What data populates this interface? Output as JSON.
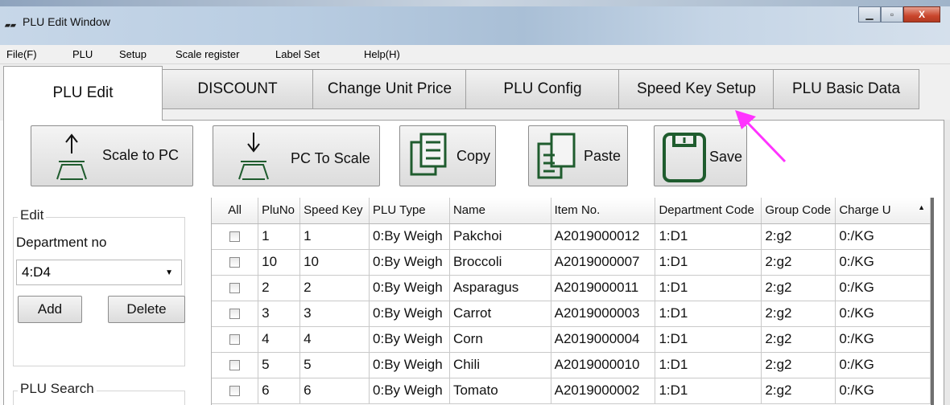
{
  "window": {
    "title": "PLU Edit Window",
    "icon": "app-logo-icon"
  },
  "menu": [
    "File(F)",
    "PLU",
    "Setup",
    "Scale register",
    "Label Set",
    "Help(H)"
  ],
  "tabs": [
    "PLU Edit",
    "DISCOUNT",
    "Change Unit Price",
    "PLU Config",
    "Speed Key Setup",
    "PLU Basic Data"
  ],
  "active_tab": "PLU Edit",
  "toolbar": {
    "scale_to_pc": "Scale to PC",
    "pc_to_scale": "PC To Scale",
    "copy": "Copy",
    "paste": "Paste",
    "save": "Save"
  },
  "left_panel": {
    "edit_group": "Edit",
    "department_label": "Department no",
    "department_value": "4:D4",
    "add": "Add",
    "delete": "Delete",
    "search_group": "PLU Search"
  },
  "grid": {
    "columns": [
      "All",
      "PluNo",
      "Speed Key",
      "PLU Type",
      "Name",
      "Item No.",
      "Department Code",
      "Group Code",
      "Charge U"
    ],
    "rows": [
      [
        "1",
        "1",
        "0:By Weigh",
        "Pakchoi",
        "A2019000012",
        "1:D1",
        "2:g2",
        "0:/KG"
      ],
      [
        "10",
        "10",
        "0:By Weigh",
        "Broccoli",
        "A2019000007",
        "1:D1",
        "2:g2",
        "0:/KG"
      ],
      [
        "2",
        "2",
        "0:By Weigh",
        "Asparagus",
        "A2019000011",
        "1:D1",
        "2:g2",
        "0:/KG"
      ],
      [
        "3",
        "3",
        "0:By Weigh",
        "Carrot",
        "A2019000003",
        "1:D1",
        "2:g2",
        "0:/KG"
      ],
      [
        "4",
        "4",
        "0:By Weigh",
        "Corn",
        "A2019000004",
        "1:D1",
        "2:g2",
        "0:/KG"
      ],
      [
        "5",
        "5",
        "0:By Weigh",
        "Chili",
        "A2019000010",
        "1:D1",
        "2:g2",
        "0:/KG"
      ],
      [
        "6",
        "6",
        "0:By Weigh",
        "Tomato",
        "A2019000002",
        "1:D1",
        "2:g2",
        "0:/KG"
      ]
    ]
  },
  "colors": {
    "save_icon": "#1f5c2e",
    "annotation_arrow": "#ff33ff"
  }
}
